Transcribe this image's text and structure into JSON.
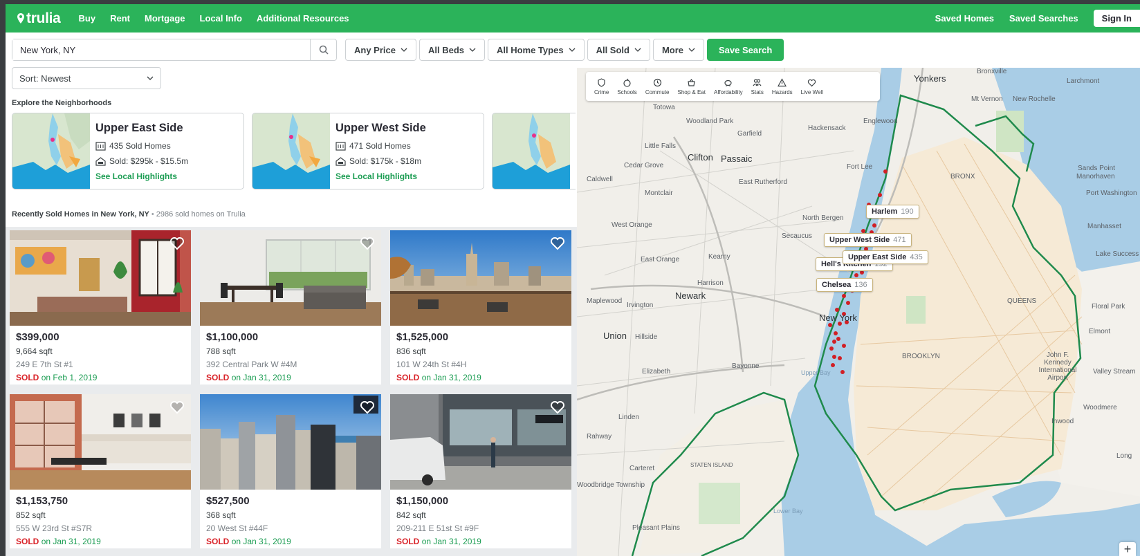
{
  "header": {
    "logo_text": "trulia",
    "nav": [
      "Buy",
      "Rent",
      "Mortgage",
      "Local Info",
      "Additional Resources"
    ],
    "saved_homes": "Saved Homes",
    "saved_searches": "Saved Searches",
    "sign_in": "Sign In"
  },
  "filters": {
    "location": "New York, NY",
    "price": "Any Price",
    "beds": "All Beds",
    "home_types": "All Home Types",
    "sold": "All Sold",
    "more": "More",
    "save_search": "Save Search",
    "sort": "Sort: Newest"
  },
  "neighborhoods": {
    "title": "Explore the Neighborhoods",
    "items": [
      {
        "name": "Upper East Side",
        "count": "435 Sold Homes",
        "range": "Sold: $295k - $15.5m",
        "link": "See Local Highlights"
      },
      {
        "name": "Upper West Side",
        "count": "471 Sold Homes",
        "range": "Sold: $175k - $18m",
        "link": "See Local Highlights"
      }
    ]
  },
  "recent": {
    "title": "Recently Sold Homes in New York, NY",
    "subtitle": "2986 sold homes on Trulia"
  },
  "listings": [
    {
      "price": "$399,000",
      "sqft": "9,664 sqft",
      "address": "249 E 7th St #1",
      "sold": "SOLD",
      "date": "on Feb 1, 2019"
    },
    {
      "price": "$1,100,000",
      "sqft": "788 sqft",
      "address": "392 Central Park W #4M",
      "sold": "SOLD",
      "date": "on Jan 31, 2019"
    },
    {
      "price": "$1,525,000",
      "sqft": "836 sqft",
      "address": "101 W 24th St #4H",
      "sold": "SOLD",
      "date": "on Jan 31, 2019"
    },
    {
      "price": "$1,153,750",
      "sqft": "852 sqft",
      "address": "555 W 23rd St #S7R",
      "sold": "SOLD",
      "date": "on Jan 31, 2019"
    },
    {
      "price": "$527,500",
      "sqft": "368 sqft",
      "address": "20 West St #44F",
      "sold": "SOLD",
      "date": "on Jan 31, 2019"
    },
    {
      "price": "$1,150,000",
      "sqft": "842 sqft",
      "address": "209-211 E 51st St #9F",
      "sold": "SOLD",
      "date": "on Jan 31, 2019"
    }
  ],
  "map": {
    "layers": [
      "Crime",
      "Schools",
      "Commute",
      "Shop & Eat",
      "Affordability",
      "Stats",
      "Hazards",
      "Live Well"
    ],
    "pills": [
      {
        "name": "Harlem",
        "count": "190"
      },
      {
        "name": "Upper West Side",
        "count": "471"
      },
      {
        "name": "Upper East Side",
        "count": "435"
      },
      {
        "name": "Hell's Kitchen",
        "count": "192"
      },
      {
        "name": "Chelsea",
        "count": "136"
      }
    ],
    "labels": [
      "Yonkers",
      "Bronxville",
      "Larchmont",
      "Mt Vernon",
      "New Rochelle",
      "Totowa",
      "Woodland Park",
      "Garfield",
      "Hackensack",
      "Englewood",
      "Little Falls",
      "Clifton",
      "Passaic",
      "Fort Lee",
      "Cedar Grove",
      "Caldwell",
      "Montclair",
      "East Rutherford",
      "North Bergen",
      "West Orange",
      "Secaucus",
      "East Orange",
      "Kearny",
      "Harrison",
      "Newark",
      "Maplewood",
      "Irvington",
      "Union",
      "Hillside",
      "Elizabeth",
      "Bayonne",
      "New York",
      "BROOKLYN",
      "QUEENS",
      "BRONX",
      "Sands Point",
      "Manorhaven",
      "Port Washington",
      "Manhasset",
      "Lake Success",
      "Floral Park",
      "Elmont",
      "Valley Stream",
      "John F. Kennedy International Airport",
      "Woodmere",
      "Inwood",
      "Linden",
      "Rahway",
      "Carteret",
      "STATEN ISLAND",
      "Woodbridge Township",
      "Pleasant Plains",
      "Upper Bay",
      "Lower Bay",
      "Long"
    ],
    "zoom_in": "+"
  },
  "colors": {
    "brand": "#2bb35a",
    "link": "#1c9d53",
    "sold": "#d92228"
  }
}
